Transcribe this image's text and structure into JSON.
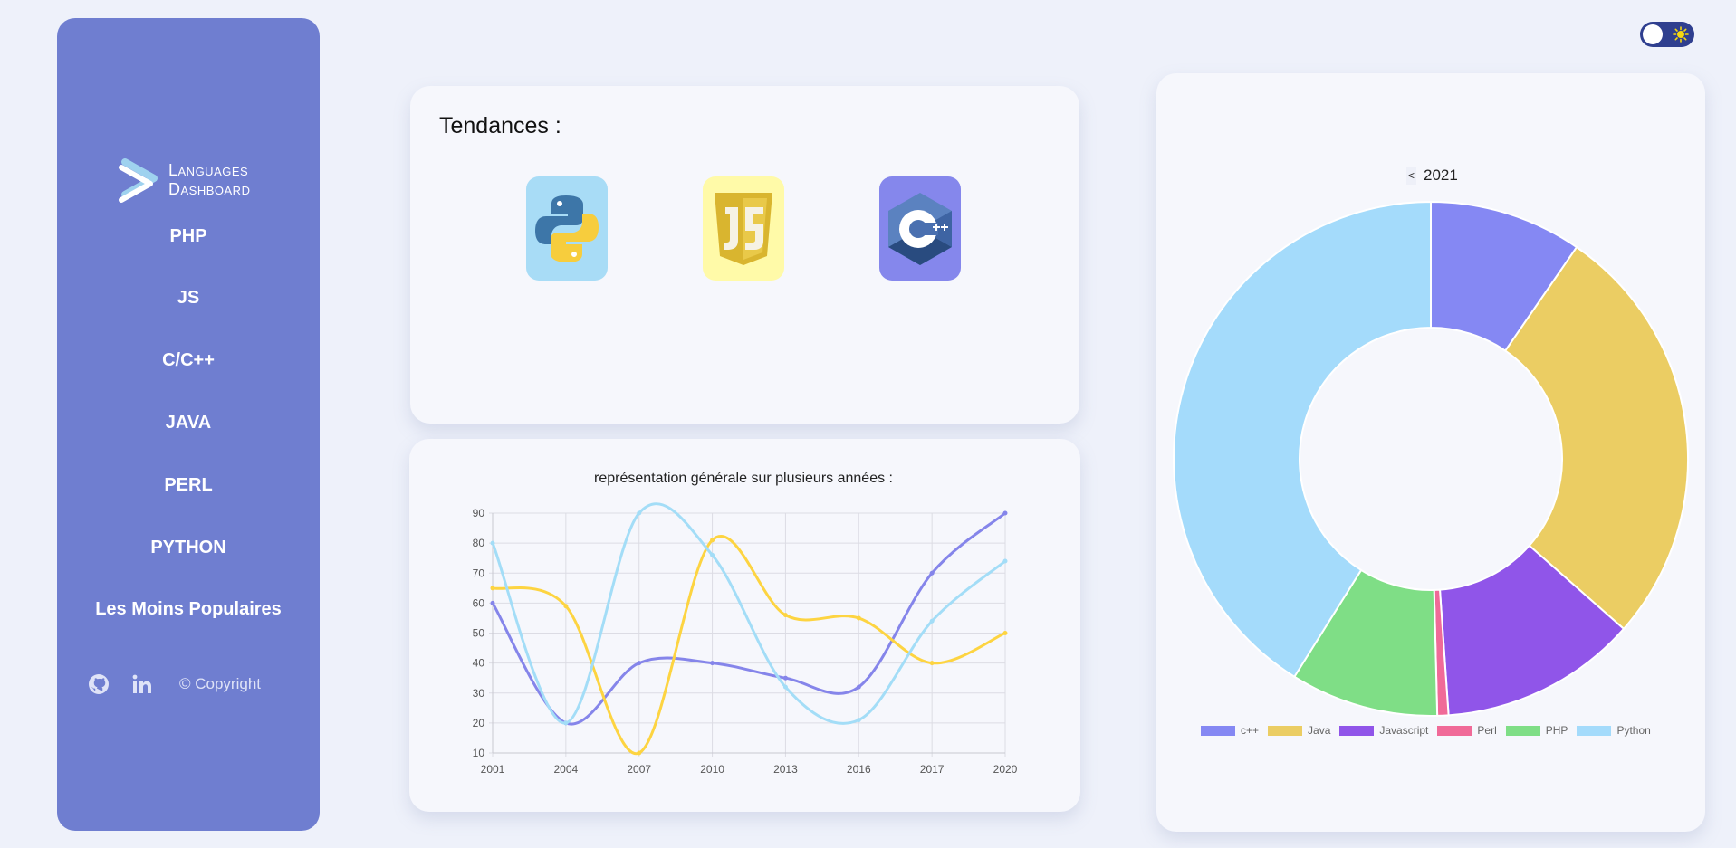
{
  "sidebar": {
    "logo": {
      "line1": "Languages",
      "line2": "Dashboard"
    },
    "items": [
      {
        "label": "PHP"
      },
      {
        "label": "JS"
      },
      {
        "label": "C/C++"
      },
      {
        "label": "JAVA"
      },
      {
        "label": "PERL"
      },
      {
        "label": "PYTHON"
      },
      {
        "label": "Les Moins Populaires"
      }
    ],
    "footer": {
      "copyright": "© Copyright",
      "icons": [
        "github-icon",
        "linkedin-icon"
      ]
    }
  },
  "theme_toggle": {
    "state": "light",
    "icon": "sun-icon"
  },
  "trends": {
    "title": "Tendances :",
    "languages": [
      {
        "name": "Python",
        "icon": "python-icon",
        "tile_color": "#a8dcf6"
      },
      {
        "name": "JavaScript",
        "icon": "js-icon",
        "tile_color": "#fffaa8"
      },
      {
        "name": "C++",
        "icon": "cpp-icon",
        "tile_color": "#8587ec"
      }
    ]
  },
  "line_chart": {
    "title": "représentation générale sur plusieurs années :"
  },
  "donut": {
    "year": "2021",
    "prev_symbol": "<"
  },
  "chart_data": [
    {
      "type": "line",
      "title": "représentation générale sur plusieurs années :",
      "x": [
        "2001",
        "2004",
        "2007",
        "2010",
        "2013",
        "2016",
        "2017",
        "2020"
      ],
      "ylim": [
        10,
        90
      ],
      "yticks": [
        10,
        20,
        30,
        40,
        50,
        60,
        70,
        80,
        90
      ],
      "grid": true,
      "series": [
        {
          "color": "#8585ea",
          "values": [
            60,
            20,
            40,
            40,
            35,
            32,
            70,
            90
          ]
        },
        {
          "color": "#fdd441",
          "values": [
            65,
            59,
            10,
            81,
            56,
            55,
            40,
            50
          ]
        },
        {
          "color": "#a3ddf7",
          "values": [
            80,
            20,
            90,
            76,
            32,
            21,
            54,
            74
          ]
        }
      ]
    },
    {
      "type": "pie",
      "donut": true,
      "legend": "bottom",
      "categories": [
        "c++",
        "Java",
        "Javascript",
        "Perl",
        "PHP",
        "Python"
      ],
      "values": [
        9.6,
        26.9,
        12.4,
        0.7,
        9.3,
        41.1
      ],
      "colors": [
        "#8588f3",
        "#ebcd63",
        "#9055e9",
        "#f06a98",
        "#7fde86",
        "#a4dbfb"
      ]
    }
  ]
}
